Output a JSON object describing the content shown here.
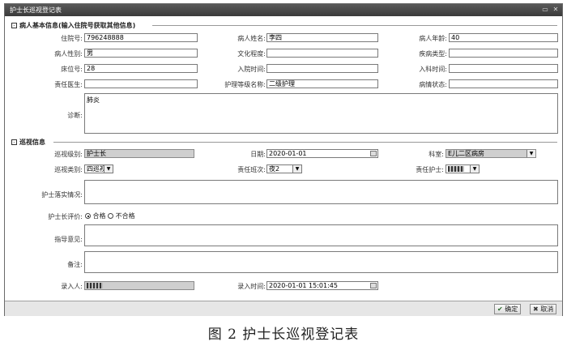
{
  "window": {
    "title": "护士长巡视登记表",
    "minimize_label": "▭",
    "close_label": "✕"
  },
  "patient_section": {
    "title": "病人基本信息(输入住院号获取其他信息)",
    "fields": {
      "admission_no": {
        "label": "住院号:",
        "value": "796248888"
      },
      "name": {
        "label": "病人姓名:",
        "value": "李四"
      },
      "age": {
        "label": "病人年龄:",
        "value": "40"
      },
      "gender": {
        "label": "病人性别:",
        "value": "男"
      },
      "education": {
        "label": "文化程度:",
        "value": ""
      },
      "disease_type": {
        "label": "疾病类型:",
        "value": ""
      },
      "bed_no": {
        "label": "床位号:",
        "value": "28"
      },
      "admit_time": {
        "label": "入院时间:",
        "value": ""
      },
      "dept_admit_time": {
        "label": "入科时间:",
        "value": ""
      },
      "doctor": {
        "label": "责任医生:",
        "value": ""
      },
      "care_level": {
        "label": "护理等级名称:",
        "value": "二级护理"
      },
      "condition": {
        "label": "病情状态:",
        "value": ""
      },
      "diagnosis": {
        "label": "诊断:",
        "value": "肺炎"
      }
    }
  },
  "patrol_section": {
    "title": "巡视信息",
    "fields": {
      "level": {
        "label": "巡视级别:",
        "value": "护士长"
      },
      "date": {
        "label": "日期:",
        "value": "2020-01-01"
      },
      "department": {
        "label": "科室:",
        "value": "E儿二区病房"
      },
      "category": {
        "label": "巡视类别:",
        "value": "四巡视"
      },
      "shift": {
        "label": "责任班次:",
        "value": "夜2"
      },
      "nurse": {
        "label": "责任护士:",
        "value": ""
      },
      "implementation": {
        "label": "护士落实情况:",
        "value": ""
      },
      "evaluation": {
        "label": "护士长评价:",
        "option_pass": "合格",
        "option_fail": "不合格",
        "selected": "合格"
      },
      "guidance": {
        "label": "指导意见:",
        "value": ""
      },
      "remarks": {
        "label": "备注:",
        "value": ""
      },
      "entered_by": {
        "label": "录入人:",
        "value": ""
      },
      "entry_time": {
        "label": "录入时间:",
        "value": "2020-01-01 15:01:45"
      }
    }
  },
  "buttons": {
    "confirm": "确定",
    "cancel": "取消"
  },
  "caption": "图 2   护士长巡视登记表"
}
